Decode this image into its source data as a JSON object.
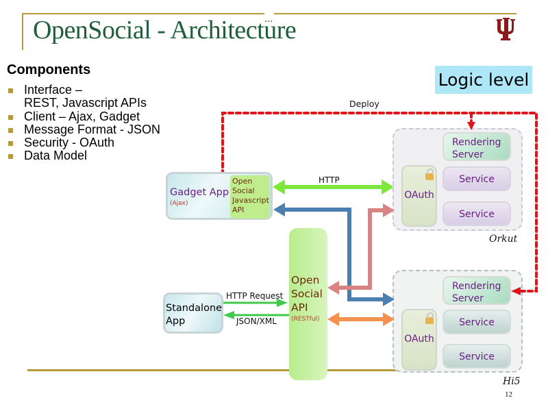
{
  "slide": {
    "title": "OpenSocial - Architecture",
    "logo": "iu-trident-icon",
    "page_number": "12"
  },
  "components": {
    "heading": "Components",
    "items": [
      {
        "line1": "Interface –",
        "line2": "REST, Javascript APIs"
      },
      {
        "line1": "Client – Ajax, Gadget"
      },
      {
        "line1": "Message Format - JSON"
      },
      {
        "line1": "Security - OAuth"
      },
      {
        "line1": "Data Model"
      }
    ]
  },
  "diagram": {
    "logic_level_label": "Logic level",
    "deploy_label": "Deploy",
    "http_label": "HTTP",
    "http_request_label": "HTTP Request",
    "json_xml_label": "JSON/XML",
    "gadget_app": {
      "title": "Gadget App",
      "subtitle": "(Ajax)"
    },
    "gadget_api": {
      "lines": [
        "Open",
        "Social",
        "Javascript",
        "API"
      ]
    },
    "standalone_app": {
      "line1": "Standalone",
      "line2": "App"
    },
    "opensocial_api": {
      "lines": [
        "Open",
        "Social",
        "API"
      ],
      "subtitle": "(RESTful)"
    },
    "containers": [
      {
        "name": "Orkut",
        "rendering_server": {
          "line1": "Rendering",
          "line2": "Server"
        },
        "oauth": "OAuth",
        "services": [
          "Service",
          "Service"
        ]
      },
      {
        "name": "Hi5",
        "rendering_server": {
          "line1": "Rendering",
          "line2": "Server"
        },
        "oauth": "OAuth",
        "services": [
          "Service",
          "Service"
        ]
      }
    ],
    "colors": {
      "deploy": "#e0141b",
      "http": "#7de83a",
      "blue_arrow": "#4a7fb0",
      "pink_arrow": "#d98383",
      "orange_arrow": "#f5914f",
      "standalone_arrows": "#3fc84a",
      "accent_rule": "#b59a3c",
      "title": "#1f5e3a"
    }
  }
}
